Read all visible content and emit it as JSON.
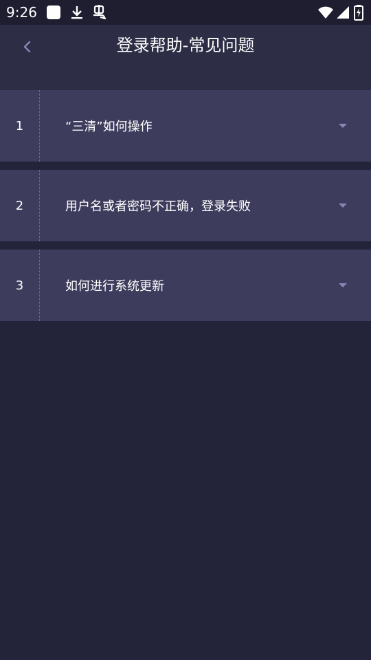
{
  "status_bar": {
    "time": "9:26",
    "icons": [
      "notification-square-icon",
      "download-icon",
      "bug-icon",
      "wifi-icon",
      "signal-icon",
      "battery-charging-icon"
    ]
  },
  "header": {
    "title": "登录帮助-常见问题",
    "back_icon": "chevron-left-icon"
  },
  "faq": {
    "items": [
      {
        "index": "1",
        "question": "“三清”如何操作"
      },
      {
        "index": "2",
        "question": "用户名或者密码不正确，登录失败"
      },
      {
        "index": "3",
        "question": "如何进行系统更新"
      }
    ]
  },
  "colors": {
    "background": "#23233a",
    "header": "#2d2d45",
    "item": "#3e3c5c",
    "accent": "#8a86b5"
  }
}
